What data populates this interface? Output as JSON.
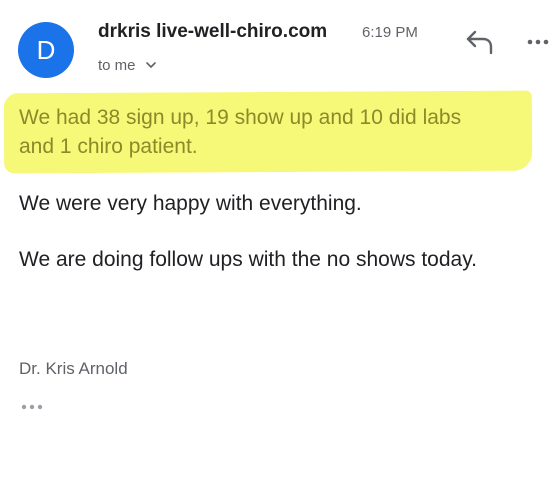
{
  "header": {
    "avatar_letter": "D",
    "sender": "drkris live-well-chiro.com",
    "time": "6:19 PM",
    "recipient": "to me",
    "icons": {
      "reply": "reply-icon",
      "more": "more-horizontal-icon",
      "chevron": "chevron-down-icon"
    }
  },
  "body": {
    "highlighted_line_1": "We had 38 sign up, 19 show up and 10 did labs",
    "highlighted_line_2": "and 1 chiro patient.",
    "paragraph_2": "We were very happy with everything.",
    "paragraph_3": "We are doing follow ups with the no shows today.",
    "signature": "Dr. Kris Arnold",
    "trimmed_icon": "ellipsis-icon"
  },
  "colors": {
    "avatar": "#1a73e8",
    "highlight": "#f6f878",
    "highlighted_text": "#8a8a2a",
    "secondary_text": "#5f6368"
  }
}
